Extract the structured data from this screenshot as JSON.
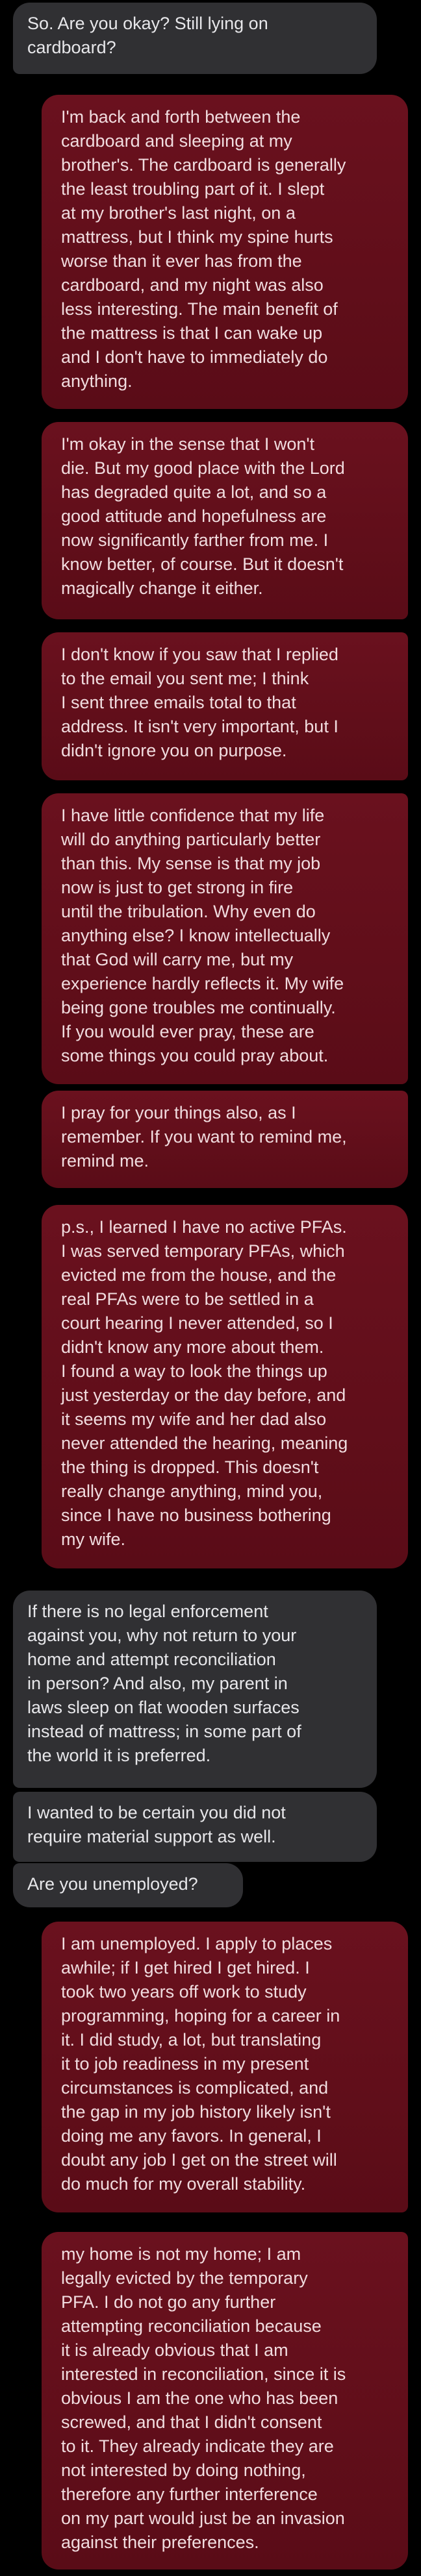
{
  "conversation": {
    "messages": [
      {
        "sender": "other",
        "text": "So. Are you okay? Still lying on\ncardboard?"
      },
      {
        "sender": "me",
        "text": "I'm back and forth between the\ncardboard and sleeping at my\nbrother's. The cardboard is generally\nthe least troubling part of it. I slept\nat my brother's last night, on a\nmattress, but I think my spine hurts\nworse than it ever has from the\ncardboard, and my night was also\nless interesting. The main benefit of\nthe mattress is that I can wake up\nand I don't have to immediately do\nanything."
      },
      {
        "sender": "me",
        "text": "I'm okay in the sense that I won't\ndie. But my good place with the Lord\nhas degraded quite a lot, and so a\ngood attitude and hopefulness are\nnow significantly farther from me. I\nknow better, of course. But it doesn't\nmagically change it either."
      },
      {
        "sender": "me",
        "text": "I don't know if you saw that I replied\nto the email you sent me; I think\nI sent three emails total to that\naddress. It isn't very important, but I\ndidn't ignore you on purpose."
      },
      {
        "sender": "me",
        "text": "I have little confidence that my life\nwill do anything particularly better\nthan this. My sense is that my job\nnow is just to get strong in fire\nuntil the tribulation. Why even do\nanything else? I know intellectually\nthat God will carry me, but my\nexperience hardly reflects it. My wife\nbeing gone troubles me continually.\nIf you would ever pray, these are\nsome things you could pray about."
      },
      {
        "sender": "me",
        "text": "I pray for your things also, as I\nremember. If you want to remind me,\nremind me."
      },
      {
        "sender": "me",
        "text": "p.s., I learned I have no active PFAs.\nI was served temporary PFAs, which\nevicted me from the house, and the\nreal PFAs were to be settled in a\ncourt hearing I never attended, so I\ndidn't know any more about them.\nI found a way to look the things up\njust yesterday or the day before, and\nit seems my wife and her dad also\nnever attended the hearing, meaning\nthe thing is dropped. This doesn't\nreally change anything, mind you,\nsince I have no business bothering\nmy wife."
      },
      {
        "sender": "other",
        "text": "If there is no legal enforcement\nagainst you, why not return to your\nhome and attempt reconciliation\nin person? And also, my parent in\nlaws sleep on flat wooden surfaces\ninstead of mattress; in some part of\nthe world it is preferred."
      },
      {
        "sender": "other",
        "text": "I wanted to be certain you did not\nrequire material support as well."
      },
      {
        "sender": "other",
        "text": "Are you unemployed?"
      },
      {
        "sender": "me",
        "text": "I am unemployed. I apply to places\nawhile; if I get hired I get hired. I\ntook two years off work to study\nprogramming, hoping for a career in\nit. I did study, a lot, but translating\nit to job readiness in my present\ncircumstances is complicated, and\nthe gap in my job history likely isn't\ndoing me any favors. In general, I\ndoubt any job I get on the street will\ndo much for my overall stability."
      },
      {
        "sender": "me",
        "text": "my home is not my home; I am\nlegally evicted by the temporary\nPFA. I do not go any further\nattempting reconciliation because\nit is already obvious that I am\ninterested in reconciliation, since it is\nobvious I am the one who has been\nscrewed, and that I didn't consent\nto it. They already indicate they are\nnot interested by doing nothing,\ntherefore any further interference\non my part would just be an invasion\nagainst their preferences."
      }
    ]
  }
}
